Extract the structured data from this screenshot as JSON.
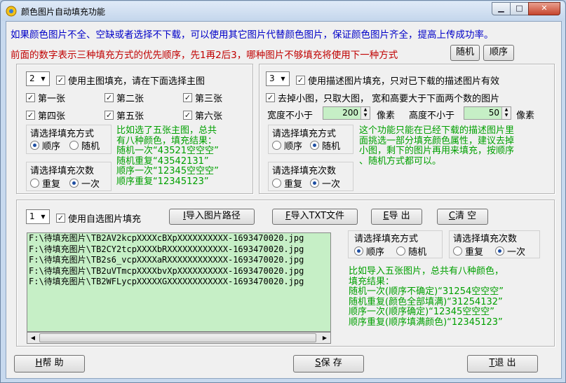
{
  "window": {
    "title": "颜色图片自动填充功能",
    "min": "▁",
    "max": "□",
    "close": "✕"
  },
  "header": {
    "line1": "如果颜色图片不全、空缺或者选择不下载，可以使用其它图片代替颜色图片，保证颜色图片齐全，提高上传成功率。",
    "line2": "前面的数字表示三种填充方式的优先顺序，先1再2后3，哪种图片不够填充将使用下一种方式",
    "random_btn": "随机",
    "order_btn": "顺序"
  },
  "main_fill": {
    "priority": "2",
    "enable_label": "使用主图填充，请在下面选择主图",
    "images": [
      "第一张",
      "第二张",
      "第三张",
      "第四张",
      "第五张",
      "第六张"
    ],
    "mode_title": "请选择填充方式",
    "mode_options": [
      "顺序",
      "随机"
    ],
    "mode_selected": "顺序",
    "count_title": "请选择填充次数",
    "count_options": [
      "重复",
      "一次"
    ],
    "count_selected": "一次",
    "note": [
      "比如选了五张主图，总共",
      "有八种颜色，填充结果：",
      "随机一次“43521空空空”",
      "随机重复“43542131”",
      "顺序一次“12345空空空”",
      "顺序重复“12345123”"
    ]
  },
  "desc_fill": {
    "priority": "3",
    "enable_label": "使用描述图片填充，只对已下载的描述图片有效",
    "remove_small_label": "去掉小图，只取大图， 宽和高要大于下面两个数的图片",
    "width_label": "宽度不小于",
    "width_value": "200",
    "height_label": "高度不小于",
    "height_value": "50",
    "unit": "像素",
    "mode_title": "请选择填充方式",
    "mode_options": [
      "顺序",
      "随机"
    ],
    "mode_selected": "随机",
    "count_title": "请选择填充次数",
    "count_options": [
      "重复",
      "一次"
    ],
    "count_selected": "一次",
    "note": [
      "这个功能只能在已经下载的描述图片里",
      "面挑选一部分填充颜色属性，建议去掉",
      "小图，剩下的图片再用来填充，按顺序",
      "、随机方式都可以。"
    ]
  },
  "custom_fill": {
    "priority": "1",
    "enable_label": "使用自选图片填充",
    "import_path_key": "I",
    "import_path_label": "导入图片路径",
    "import_txt_key": "F",
    "import_txt_label": "导入TXT文件",
    "export_key": "E",
    "export_label": "导 出",
    "clear_key": "C",
    "clear_label": "清 空",
    "files": [
      "F:\\待填充图片\\TB2AV2kcpXXXXcBXpXXXXXXXXXX-1693470020.jpg",
      "F:\\待填充图片\\TB2CY2tcpXXXXbRXXXXXXXXXXXX-1693470020.jpg",
      "F:\\待填充图片\\TB2s6_vcpXXXXaRXXXXXXXXXXXX-1693470020.jpg",
      "F:\\待填充图片\\TB2uVTmcpXXXXbvXpXXXXXXXXXX-1693470020.jpg",
      "F:\\待填充图片\\TB2WFLycpXXXXXGXXXXXXXXXXXX-1693470020.jpg"
    ],
    "mode_title": "请选择填充方式",
    "mode_options": [
      "顺序",
      "随机"
    ],
    "mode_selected": "顺序",
    "count_title": "请选择填充次数",
    "count_options": [
      "重复",
      "一次"
    ],
    "count_selected": "一次",
    "note": [
      "比如导入五张图片，总共有八种颜色，",
      "填充结果：",
      "随机一次(顺序不确定)“31254空空空”",
      "随机重复(颜色全部填满)“31254132”",
      "顺序一次(顺序确定)“12345空空空”",
      "顺序重复(顺序填满颜色)“12345123”"
    ]
  },
  "footer": {
    "help_key": "H",
    "help_label": "帮  助",
    "save_key": "S",
    "save_label": "保  存",
    "exit_key": "T",
    "exit_label": "退  出"
  },
  "colors": {
    "accent_blue": "#0000c8",
    "accent_red": "#c00000",
    "note_green": "#00a000",
    "list_bg": "#c6efc6"
  }
}
